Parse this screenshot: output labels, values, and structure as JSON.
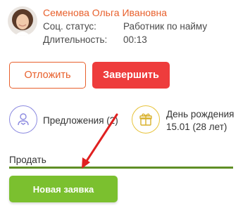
{
  "client": {
    "name": "Семенова Ольга Ивановна",
    "social_status_label": "Соц. статус:",
    "social_status_value": "Работник по найму",
    "duration_label": "Длительность:",
    "duration_value": "00:13"
  },
  "actions": {
    "postpone_label": "Отложить",
    "finish_label": "Завершить"
  },
  "widgets": {
    "offers_label": "Предложения (2)",
    "birthday_title": "День рождения",
    "birthday_date": "15.01 (28 лет)"
  },
  "sell": {
    "label": "Продать",
    "new_request_label": "Новая заявка"
  },
  "colors": {
    "accent_orange": "#e8602c",
    "finish_red": "#ee3c3c",
    "new_request_green": "#7bc02f",
    "offers_purple": "#8c8ae0",
    "birthday_yellow": "#e7c33a",
    "annotation_arrow": "#e02020"
  },
  "icons": {
    "offers": "user-handshake-icon",
    "birthday": "gift-icon"
  }
}
